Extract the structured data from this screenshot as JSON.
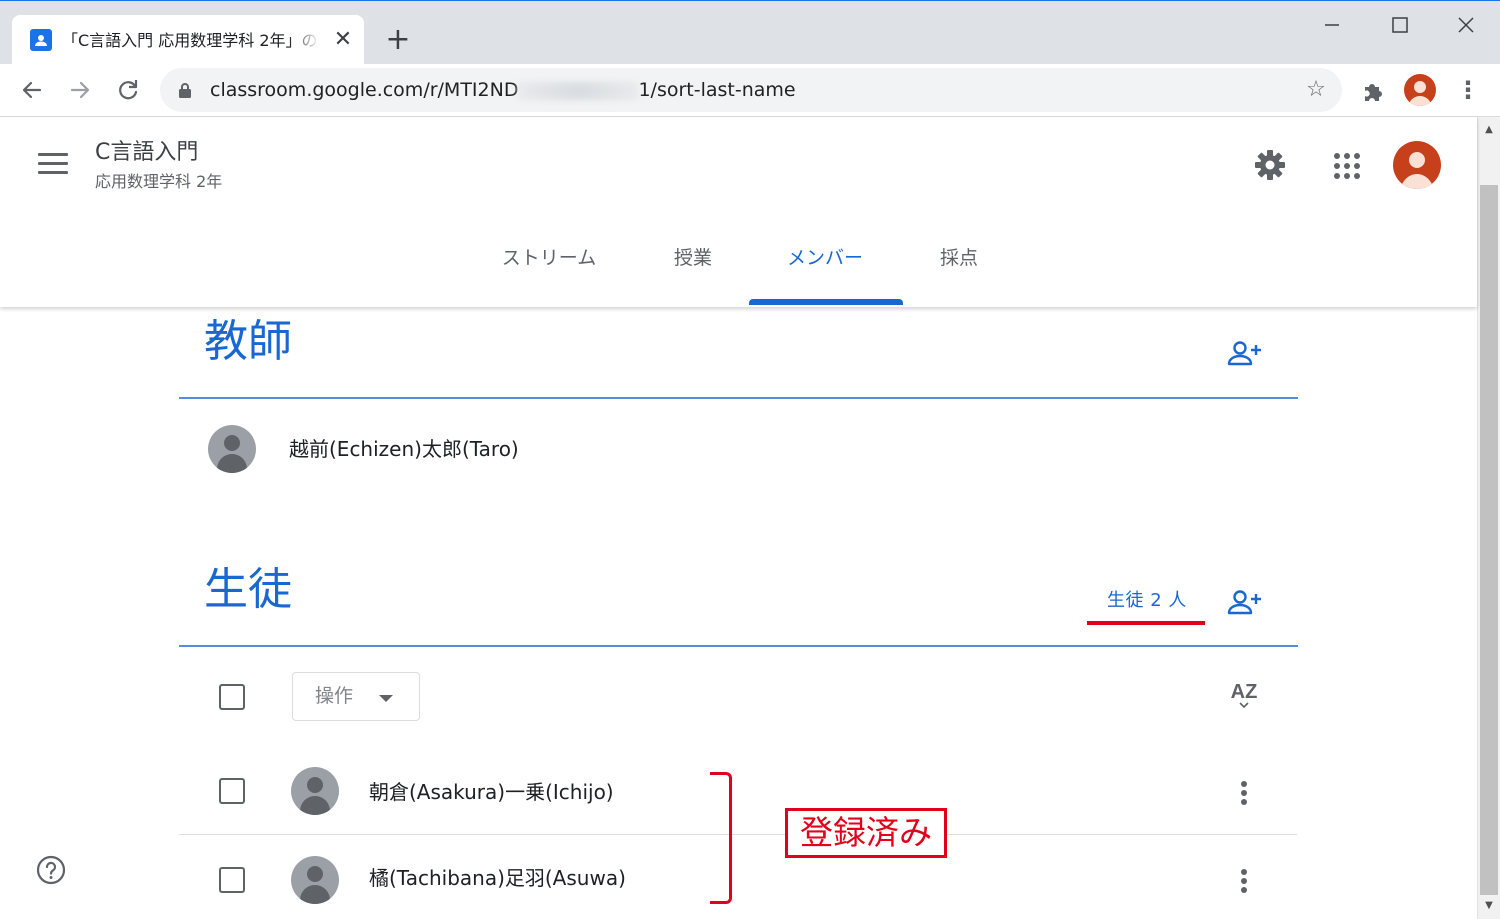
{
  "browser": {
    "tab_title": "「C言語入門 応用数理学科 2年」の",
    "tab_close": "✕",
    "new_tab": "+",
    "url_prefix": "classroom.google.com/r/MTI2ND",
    "url_suffix": "1/sort-last-name",
    "star_icon": "☆",
    "menu_icon": "⋮"
  },
  "classroom": {
    "class_name": "C言語入門",
    "class_section": "応用数理学科 2年",
    "tabs": [
      {
        "label": "ストリーム",
        "active": false
      },
      {
        "label": "授業",
        "active": false
      },
      {
        "label": "メンバー",
        "active": true
      },
      {
        "label": "採点",
        "active": false
      }
    ]
  },
  "teachers": {
    "heading": "教師",
    "list": [
      {
        "name": "越前(Echizen)太郎(Taro)"
      }
    ]
  },
  "students": {
    "heading": "生徒",
    "count_label": "生徒 2 人",
    "action_label": "操作",
    "sort_label": "AZ",
    "list": [
      {
        "name": "朝倉(Asakura)一乗(Ichijo)"
      },
      {
        "name": "橘(Tachibana)足羽(Asuwa)"
      }
    ]
  },
  "annotation": {
    "label": "登録済み",
    "color": "#e3001b"
  },
  "colors": {
    "accent": "#1967d2",
    "avatar": "#c5401b"
  }
}
